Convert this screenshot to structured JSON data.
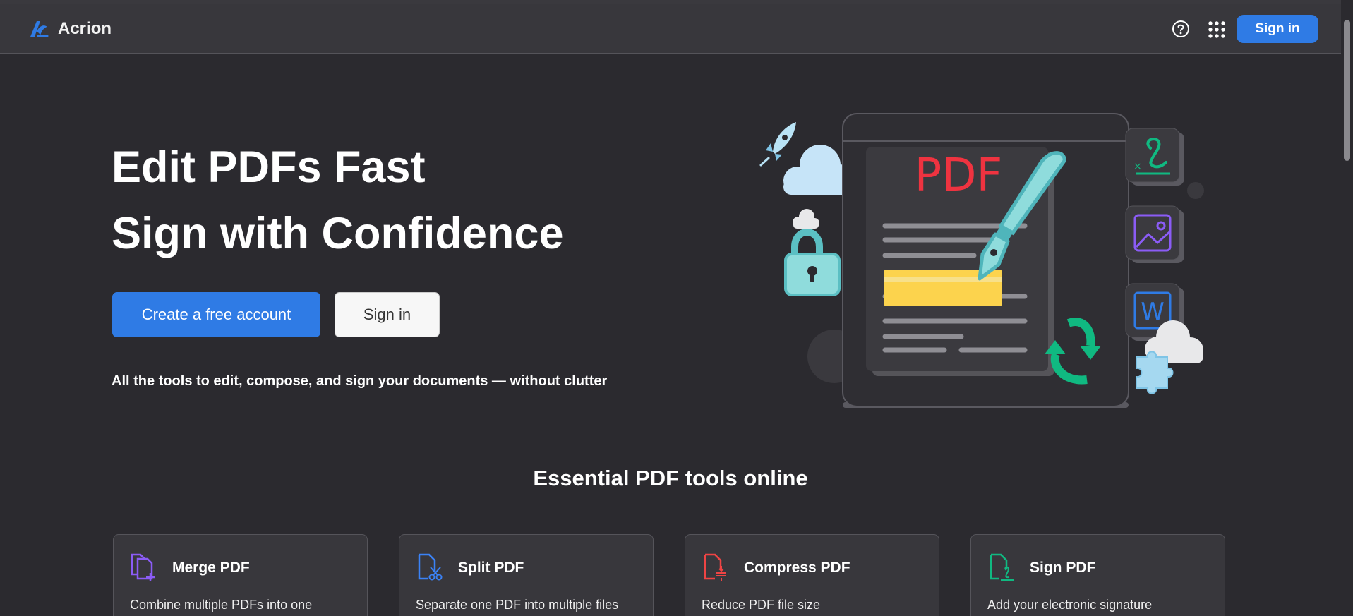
{
  "header": {
    "brand_name": "Acrion",
    "signin_label": "Sign in",
    "icons": [
      "acrion-logo-icon",
      "help-icon",
      "apps-grid-icon"
    ]
  },
  "hero": {
    "title_line1": "Edit PDFs Fast",
    "title_line2": "Sign with Confidence",
    "primary_button": "Create a free account",
    "secondary_button": "Sign in",
    "tagline": "All the tools to edit, compose, and sign your documents — without clutter",
    "illustration": {
      "pdf_label": "PDF",
      "word_label": "W",
      "icons": [
        "rocket-icon",
        "cloud-icon",
        "lock-icon",
        "pen-nib-icon",
        "signature-icon",
        "image-icon",
        "word-doc-icon",
        "sync-arrows-icon",
        "puzzle-cloud-icon"
      ]
    }
  },
  "tools": {
    "section_title": "Essential PDF tools online",
    "cards": [
      {
        "title": "Merge PDF",
        "description": "Combine multiple PDFs into one",
        "icon": "merge-pdf-icon",
        "color": "#8b5cf6"
      },
      {
        "title": "Split PDF",
        "description": "Separate one PDF into multiple files",
        "icon": "split-pdf-icon",
        "color": "#3b82f6"
      },
      {
        "title": "Compress PDF",
        "description": "Reduce PDF file size",
        "icon": "compress-pdf-icon",
        "color": "#ef4444"
      },
      {
        "title": "Sign PDF",
        "description": "Add your electronic signature",
        "icon": "sign-pdf-icon",
        "color": "#10b981"
      }
    ]
  },
  "colors": {
    "accent": "#2f7be5",
    "background": "#2b2a2f",
    "navbar": "#38373c",
    "pdf_red": "#ef3340",
    "teal": "#7fd6d6",
    "highlight_yellow": "#fcd34d",
    "green": "#10b981"
  }
}
